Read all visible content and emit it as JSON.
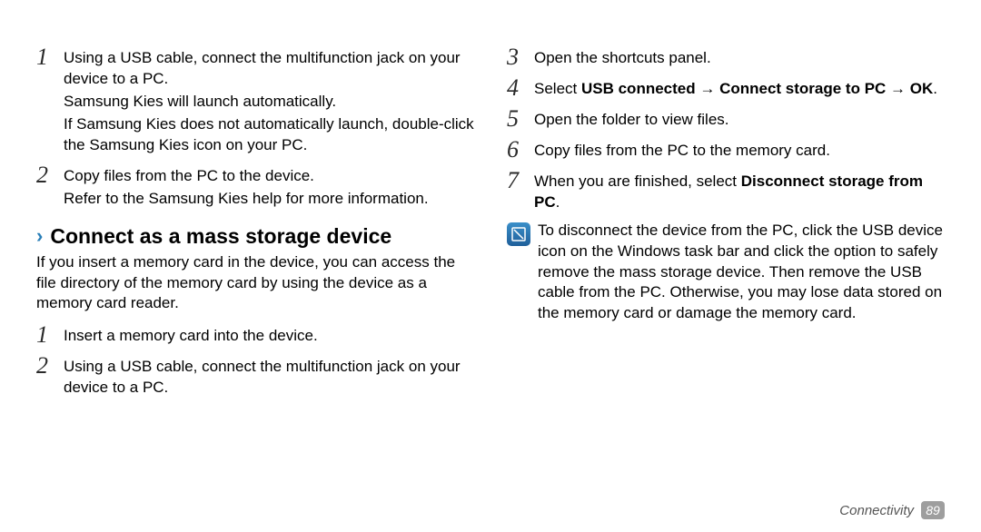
{
  "left": {
    "step1": {
      "num": "1",
      "p1": "Using a USB cable, connect the multifunction jack on your device to a PC.",
      "p2": "Samsung Kies will launch automatically.",
      "p3": "If Samsung Kies does not automatically launch, double-click the Samsung Kies icon on your PC."
    },
    "step2": {
      "num": "2",
      "p1": "Copy files from the PC to the device.",
      "p2": "Refer to the Samsung Kies help for more information."
    },
    "heading": "Connect as a mass storage device",
    "intro": "If you insert a memory card in the device, you can access the file directory of the memory card by using the device as a memory card reader.",
    "stepA": {
      "num": "1",
      "p1": "Insert a memory card into the device."
    },
    "stepB": {
      "num": "2",
      "p1": "Using a USB cable, connect the multifunction jack on your device to a PC."
    }
  },
  "right": {
    "step3": {
      "num": "3",
      "p1": "Open the shortcuts panel."
    },
    "step4": {
      "num": "4",
      "pre": "Select ",
      "b1": "USB connected",
      "arrow1": " → ",
      "b2": "Connect storage to PC",
      "arrow2": " → ",
      "b3": "OK",
      "post": "."
    },
    "step5": {
      "num": "5",
      "p1": "Open the folder to view files."
    },
    "step6": {
      "num": "6",
      "p1": "Copy files from the PC to the memory card."
    },
    "step7": {
      "num": "7",
      "pre": "When you are finished, select ",
      "b1": "Disconnect storage from PC",
      "post": "."
    },
    "note": "To disconnect the device from the PC, click the USB device icon on the Windows task bar and click the option to safely remove the mass storage device. Then remove the USB cable from the PC. Otherwise, you may lose data stored on the memory card or damage the memory card."
  },
  "footer": {
    "section": "Connectivity",
    "page": "89"
  }
}
